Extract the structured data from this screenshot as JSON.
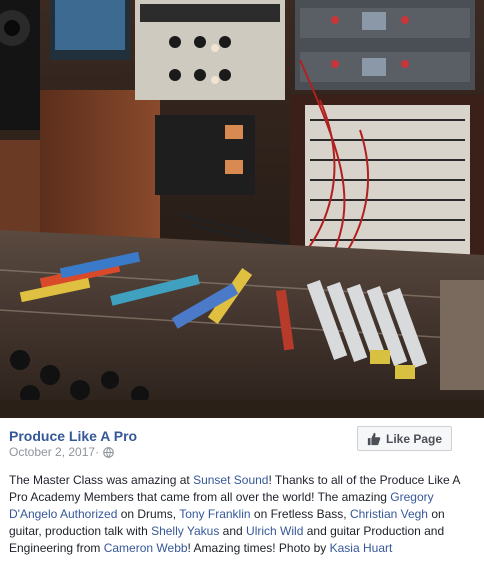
{
  "post": {
    "page_name": "Produce Like A Pro",
    "date": "October 2, 2017",
    "separator": " · ",
    "like_button_label": "Like Page",
    "text": {
      "t1": "The Master Class was amazing at ",
      "l1": "Sunset Sound",
      "t2": "! Thanks to all of the Produce Like A Pro Academy Members that came from all over the world! The amazing ",
      "l2": "Gregory D'Angelo Authorized",
      "t3": " on Drums, ",
      "l3": "Tony Franklin",
      "t4": " on Fretless Bass, ",
      "l4": "Christian Vegh",
      "t5": " on guitar, production talk with ",
      "l5": "Shelly Yakus",
      "t6": " and ",
      "l6": "Ulrich Wild",
      "t7": " and guitar Production and Engineering from ",
      "l7": "Cameron Webb",
      "t8": "! Amazing times! Photo by ",
      "l8": "Kasia Huart"
    }
  },
  "colors": {
    "link": "#365899",
    "meta": "#90949c",
    "button_bg": "#f6f7f9"
  },
  "icons": {
    "privacy": "globe-icon",
    "like": "thumb-up-icon"
  }
}
